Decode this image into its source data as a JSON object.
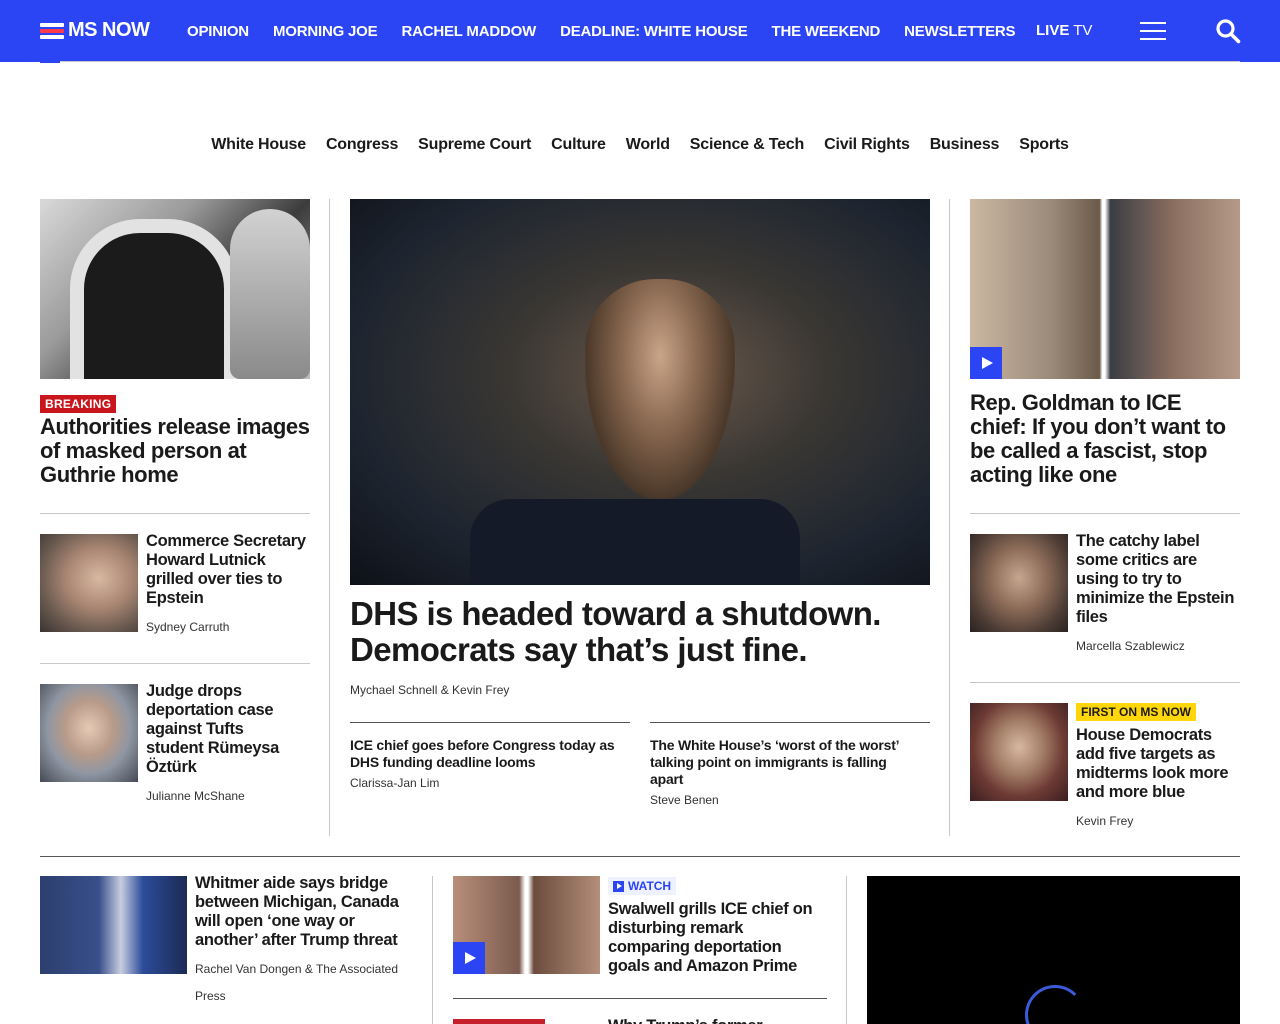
{
  "header": {
    "logo_text": "MS NOW",
    "nav": [
      "OPINION",
      "MORNING JOE",
      "RACHEL MADDOW",
      "DEADLINE: WHITE HOUSE",
      "THE WEEKEND",
      "NEWSLETTERS"
    ],
    "live_bold": "LIVE",
    "live_rest": " TV",
    "accent_color": "#2b45f5"
  },
  "subnav": [
    "White House",
    "Congress",
    "Supreme Court",
    "Culture",
    "World",
    "Science & Tech",
    "Civil Rights",
    "Business",
    "Sports"
  ],
  "left": {
    "lead": {
      "badge": "BREAKING",
      "headline": "Authorities release images of masked person at Guthrie home"
    },
    "items": [
      {
        "headline": "Commerce Secretary Howard Lutnick grilled over ties to Epstein",
        "byline": "Sydney Carruth"
      },
      {
        "headline": "Judge drops deportation case against Tufts student Rümeysa Öztürk",
        "byline": "Julianne McShane"
      }
    ]
  },
  "center": {
    "hero": {
      "headline": "DHS is headed toward a shutdown. Democrats say that’s just fine.",
      "byline": "Mychael Schnell & Kevin Frey"
    },
    "sub": [
      {
        "headline": "ICE chief goes before Congress today as DHS funding deadline looms",
        "byline": "Clarissa-Jan Lim"
      },
      {
        "headline": "The White House’s ‘worst of the worst’ talking point on immigrants is falling apart",
        "byline": "Steve Benen"
      }
    ]
  },
  "right": {
    "lead": {
      "headline": "Rep. Goldman to ICE chief: If you don’t want to be called a fascist, stop acting like one"
    },
    "items": [
      {
        "headline": "The catchy label some critics are using to try to minimize the Epstein files",
        "byline": "Marcella Szablewicz"
      },
      {
        "badge": "FIRST ON MS NOW",
        "headline": "House Democrats add five targets as midterms look more and more blue",
        "byline": "Kevin Frey"
      }
    ]
  },
  "bottom": {
    "col1": {
      "headline": "Whitmer aide says bridge between Michigan, Canada will open ‘one way or another’ after Trump threat",
      "byline": "Rachel Van Dongen & The Associated Press"
    },
    "col2": {
      "badge": "WATCH",
      "headline": "Swalwell grills ICE chief on disturbing remark comparing deportation goals and Amazon Prime",
      "next_headline": "Why Trump’s former"
    }
  }
}
